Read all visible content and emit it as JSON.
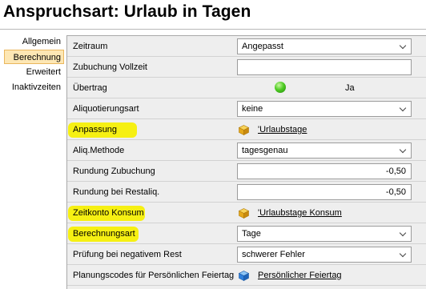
{
  "header": {
    "title": "Anspruchsart: Urlaub in Tagen"
  },
  "nav": {
    "items": [
      {
        "label": "Allgemein",
        "active": false
      },
      {
        "label": "Berechnung",
        "active": true
      },
      {
        "label": "Erweitert",
        "active": false
      },
      {
        "label": "Inaktivzeiten",
        "active": false
      }
    ]
  },
  "properties": {
    "zeitraum": {
      "label": "Zeitraum",
      "value": "Angepasst"
    },
    "zubuchung_vollzeit": {
      "label": "Zubuchung Vollzeit",
      "value": ""
    },
    "uebertrag": {
      "label": "Übertrag",
      "value": "Ja"
    },
    "aliquotierungsart": {
      "label": "Aliquotierungsart",
      "value": "keine"
    },
    "anpassung": {
      "label": "Anpassung",
      "value": "'Urlaubstage"
    },
    "aliq_methode": {
      "label": "Aliq.Methode",
      "value": "tagesgenau"
    },
    "rundung_zubuchung": {
      "label": "Rundung Zubuchung",
      "value": "-0,50"
    },
    "rundung_restaliq": {
      "label": "Rundung bei Restaliq.",
      "value": "-0,50"
    },
    "zeitkonto_konsum": {
      "label": "Zeitkonto Konsum",
      "value": "'Urlaubstage Konsum"
    },
    "berechnungsart": {
      "label": "Berechnungsart",
      "value": "Tage"
    },
    "pruefung_negativ": {
      "label": "Prüfung bei negativem Rest",
      "value": "schwerer Fehler"
    },
    "planungscodes": {
      "label": "Planungscodes für Persönlichen Feiertag",
      "value": "Persönlicher Feiertag"
    }
  },
  "colors": {
    "highlight": "#f6f000",
    "status_ok": "#4fcc24",
    "cube_gold": "#e5a81b",
    "cube_blue": "#2f7fdb",
    "nav_active_bg": "#fde7b4"
  },
  "icons": {
    "status": "green-status-dot-icon",
    "link_gold": "gold-cube-icon",
    "link_blue": "blue-cube-icon",
    "dropdown": "chevron-down-icon"
  }
}
